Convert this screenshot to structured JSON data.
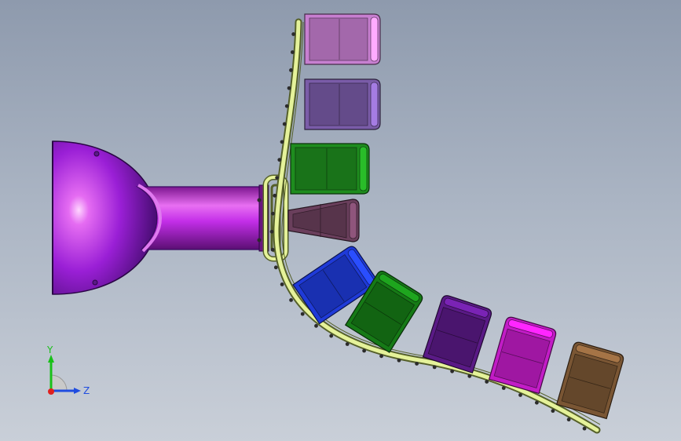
{
  "viewport": {
    "background_top": "#8e9aad",
    "background_bottom": "#c9cfd8"
  },
  "model": {
    "dome_color": "#9a1fd6",
    "arm_color": "#c32ee8",
    "track_color": "#e5f29a",
    "track_edge_color": "#55602a",
    "bolt_color": "#2b2b2b",
    "seat_colors": [
      "#c77fd0",
      "#7a5ca8",
      "#1e8c1e",
      "#6a3f5c",
      "#1f3ad8",
      "#167a16",
      "#5a1a86",
      "#c21cc6",
      "#7a5634"
    ]
  },
  "triad": {
    "y_label": "Y",
    "z_label": "Z",
    "y_color": "#19c019",
    "z_color": "#1f4ce0",
    "x_color": "#e0201f"
  }
}
